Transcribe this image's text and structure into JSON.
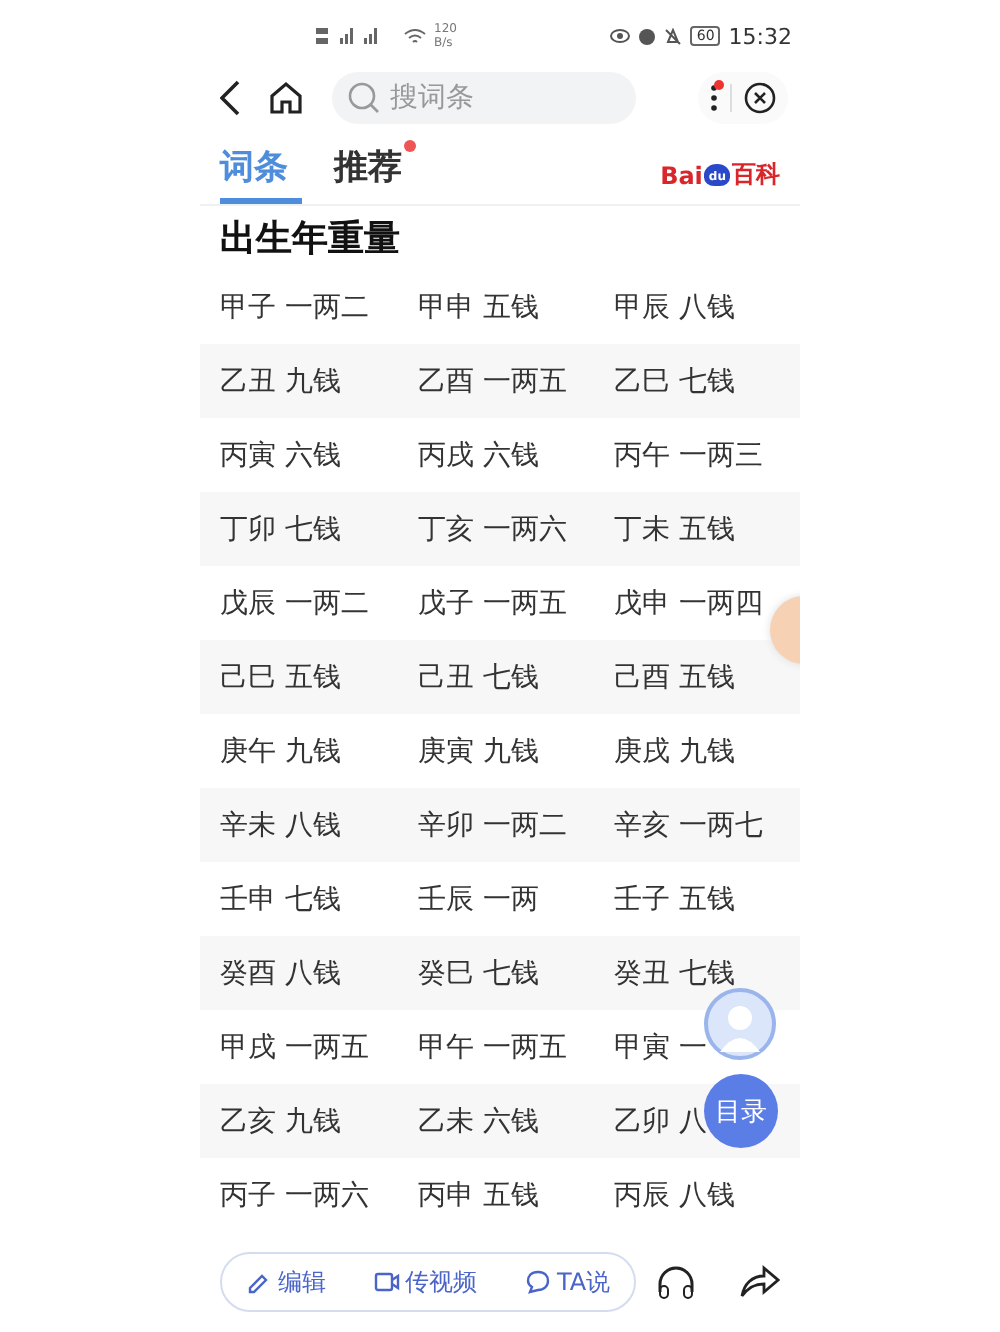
{
  "status_bar": {
    "net_speed": "120",
    "net_unit": "B/s",
    "battery": "60",
    "time": "15:32"
  },
  "nav": {
    "search_placeholder": "搜词条",
    "menu_badge": true
  },
  "tabs": [
    {
      "label": "词条",
      "selected": true,
      "badge": false
    },
    {
      "label": "推荐",
      "selected": false,
      "badge": true
    }
  ],
  "logo": {
    "left": "Bai",
    "paw": "du",
    "right": "百科"
  },
  "title": "出生年重量",
  "rows": [
    [
      "甲子 一两二",
      "甲申 五钱",
      "甲辰 八钱"
    ],
    [
      "乙丑 九钱",
      "乙酉 一两五",
      "乙巳 七钱"
    ],
    [
      "丙寅 六钱",
      "丙戌 六钱",
      "丙午 一两三"
    ],
    [
      "丁卯 七钱",
      "丁亥 一两六",
      "丁未 五钱"
    ],
    [
      "戊辰 一两二",
      "戊子 一两五",
      "戊申 一两四"
    ],
    [
      "己巳 五钱",
      "己丑 七钱",
      "己酉 五钱"
    ],
    [
      "庚午 九钱",
      "庚寅 九钱",
      "庚戌 九钱"
    ],
    [
      "辛未 八钱",
      "辛卯 一两二",
      "辛亥 一两七"
    ],
    [
      "壬申 七钱",
      "壬辰 一两",
      "壬子 五钱"
    ],
    [
      "癸酉 八钱",
      "癸巳 七钱",
      "癸丑 七钱"
    ],
    [
      "甲戌 一两五",
      "甲午 一两五",
      "甲寅 一"
    ],
    [
      "乙亥 九钱",
      "乙未 六钱",
      "乙卯 八"
    ],
    [
      "丙子 一两六",
      "丙申 五钱",
      "丙辰 八钱"
    ]
  ],
  "toc_label": "目录",
  "actions": [
    {
      "kind": "edit",
      "label": "编辑"
    },
    {
      "kind": "video",
      "label": "传视频"
    },
    {
      "kind": "chat",
      "label": "TA说"
    }
  ]
}
